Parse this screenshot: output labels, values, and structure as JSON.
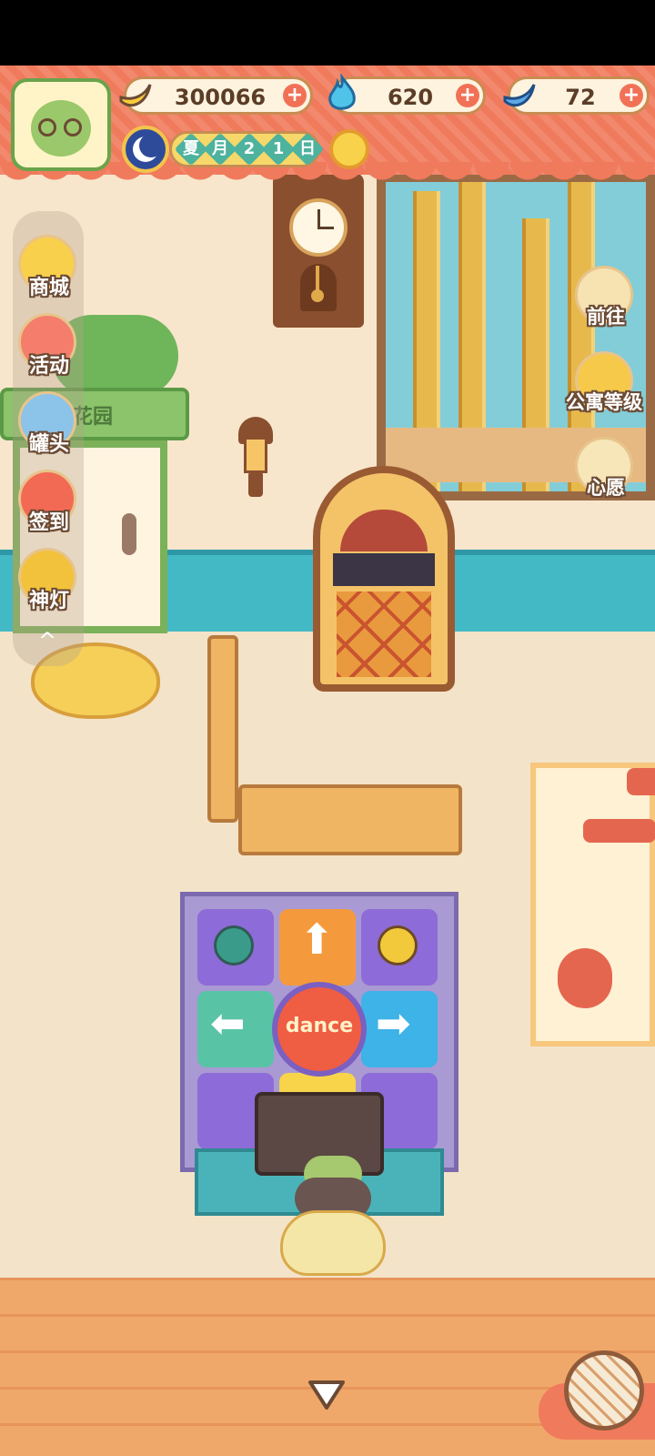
{
  "resources": [
    {
      "name": "banana",
      "icon": "banana-icon",
      "value": "300066"
    },
    {
      "name": "blue-flame",
      "icon": "blue-flame-icon",
      "value": "620"
    },
    {
      "name": "blue-banana",
      "icon": "blue-banana-icon",
      "value": "72"
    }
  ],
  "date": {
    "season": "夏",
    "month_label": "月",
    "day_digits": [
      "2",
      "1"
    ],
    "day_label": "日",
    "weather_icon": "sun-icon",
    "time_icon": "moon-clock-icon"
  },
  "left_menu": [
    {
      "label": "商城",
      "icon": "shop-icon"
    },
    {
      "label": "活动",
      "icon": "gift-icon"
    },
    {
      "label": "罐头",
      "icon": "can-icon"
    },
    {
      "label": "签到",
      "icon": "calendar-icon"
    },
    {
      "label": "神灯",
      "icon": "magic-lamp-icon"
    }
  ],
  "right_menu": [
    {
      "label": "前往",
      "icon": "map-pin-icon"
    },
    {
      "label": "公寓等级",
      "icon": "cat-medal-icon"
    },
    {
      "label": "心愿",
      "icon": "heart-book-icon"
    }
  ],
  "scene": {
    "garden_sign": "花园",
    "dance_pad_label": "dance"
  },
  "colors": {
    "header": "#f07a5c",
    "accent_teal": "#44b9c6",
    "plus_button": "#f17157"
  }
}
